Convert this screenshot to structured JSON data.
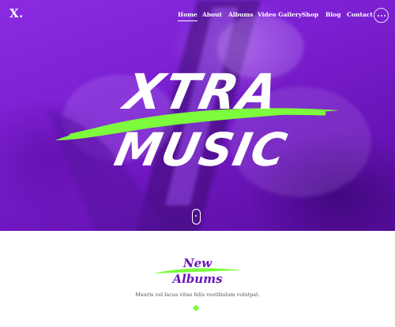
{
  "brand": {
    "logo": "X."
  },
  "nav": {
    "items": [
      {
        "label": "Home",
        "active": true
      },
      {
        "label": "About"
      },
      {
        "label": "Albums"
      },
      {
        "label": "Video Gallery"
      },
      {
        "label": "Shop"
      },
      {
        "label": "Blog"
      },
      {
        "label": "Contact"
      }
    ]
  },
  "hero": {
    "line1": "XTRA",
    "line2": "MUSIC"
  },
  "albums_section": {
    "title_line1": "New",
    "title_line2": "Albums",
    "description": "Mauris vel lacus vitae felis vestibulum volutpat."
  },
  "colors": {
    "purple": "#7a1fd0",
    "accent_green": "#7cfc3c",
    "title_purple": "#6a14b8"
  }
}
